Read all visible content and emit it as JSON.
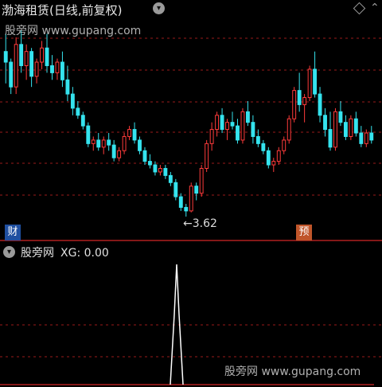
{
  "header": {
    "title": "渤海租赁(日线,前复权)",
    "dropdown_icon": "chevron-down-icon",
    "settings_icon": "diamond-icon",
    "collapse_icon": "chevron-up-icon"
  },
  "main_chart": {
    "watermark": "股旁网 www.gupang.com",
    "low_marker": "←3.62",
    "badges": {
      "finance": "财",
      "forecast": "预"
    },
    "colors": {
      "up": "#ff3b3b",
      "down": "#35e3ee",
      "grid": "#9a1a1a"
    },
    "candles": [
      [
        5.2,
        5.45,
        4.75,
        5.05
      ],
      [
        5.05,
        5.1,
        4.6,
        4.7
      ],
      [
        4.7,
        5.4,
        4.6,
        5.3
      ],
      [
        5.3,
        5.5,
        4.9,
        5.0
      ],
      [
        5.0,
        5.3,
        4.8,
        5.2
      ],
      [
        5.2,
        5.25,
        4.7,
        4.85
      ],
      [
        4.85,
        5.1,
        4.75,
        5.05
      ],
      [
        5.05,
        5.35,
        4.95,
        5.25
      ],
      [
        5.25,
        5.45,
        4.9,
        5.0
      ],
      [
        5.0,
        5.15,
        4.8,
        4.9
      ],
      [
        4.9,
        5.1,
        4.8,
        5.05
      ],
      [
        5.05,
        5.2,
        4.7,
        4.8
      ],
      [
        4.8,
        5.0,
        4.5,
        4.6
      ],
      [
        4.6,
        4.7,
        4.3,
        4.4
      ],
      [
        4.4,
        4.5,
        4.25,
        4.3
      ],
      [
        4.3,
        4.35,
        4.1,
        4.15
      ],
      [
        4.15,
        4.2,
        3.85,
        3.9
      ],
      [
        3.9,
        4.0,
        3.8,
        3.95
      ],
      [
        3.95,
        4.05,
        3.8,
        3.85
      ],
      [
        3.85,
        4.0,
        3.75,
        3.95
      ],
      [
        3.95,
        4.05,
        3.8,
        3.88
      ],
      [
        3.88,
        3.95,
        3.65,
        3.7
      ],
      [
        3.7,
        3.85,
        3.65,
        3.8
      ],
      [
        3.8,
        4.05,
        3.75,
        4.0
      ],
      [
        4.0,
        4.15,
        3.95,
        4.1
      ],
      [
        4.1,
        4.2,
        3.9,
        3.95
      ],
      [
        3.95,
        4.0,
        3.75,
        3.8
      ],
      [
        3.8,
        3.85,
        3.6,
        3.65
      ],
      [
        3.65,
        3.75,
        3.55,
        3.6
      ],
      [
        3.6,
        3.65,
        3.45,
        3.5
      ],
      [
        3.5,
        3.6,
        3.45,
        3.55
      ],
      [
        3.55,
        3.6,
        3.4,
        3.45
      ],
      [
        3.45,
        3.5,
        3.3,
        3.35
      ],
      [
        3.35,
        3.4,
        3.1,
        3.15
      ],
      [
        3.15,
        3.2,
        2.95,
        3.0
      ],
      [
        3.0,
        3.05,
        2.87,
        2.95
      ],
      [
        2.95,
        3.35,
        2.93,
        3.3
      ],
      [
        3.3,
        3.35,
        3.1,
        3.2
      ],
      [
        3.2,
        3.6,
        3.15,
        3.55
      ],
      [
        3.55,
        3.95,
        3.5,
        3.9
      ],
      [
        3.9,
        4.2,
        3.8,
        4.1
      ],
      [
        4.1,
        4.35,
        4.0,
        4.3
      ],
      [
        4.3,
        4.4,
        4.05,
        4.1
      ],
      [
        4.1,
        4.25,
        3.95,
        4.2
      ],
      [
        4.2,
        4.35,
        4.1,
        4.15
      ],
      [
        4.15,
        4.25,
        3.9,
        3.95
      ],
      [
        3.95,
        4.4,
        3.9,
        4.35
      ],
      [
        4.35,
        4.5,
        4.15,
        4.2
      ],
      [
        4.2,
        4.3,
        3.9,
        4.0
      ],
      [
        4.0,
        4.1,
        3.85,
        3.9
      ],
      [
        3.9,
        3.95,
        3.75,
        3.8
      ],
      [
        3.8,
        3.85,
        3.55,
        3.6
      ],
      [
        3.6,
        3.7,
        3.5,
        3.65
      ],
      [
        3.65,
        3.85,
        3.6,
        3.8
      ],
      [
        3.8,
        4.0,
        3.75,
        3.95
      ],
      [
        3.95,
        4.3,
        3.9,
        4.25
      ],
      [
        4.25,
        4.7,
        4.2,
        4.65
      ],
      [
        4.65,
        4.9,
        4.35,
        4.45
      ],
      [
        4.45,
        4.6,
        4.2,
        4.55
      ],
      [
        4.55,
        5.0,
        4.5,
        4.95
      ],
      [
        4.95,
        5.2,
        4.55,
        4.6
      ],
      [
        4.6,
        4.7,
        4.2,
        4.3
      ],
      [
        4.3,
        4.4,
        4.0,
        4.1
      ],
      [
        4.1,
        4.35,
        3.8,
        3.85
      ],
      [
        3.85,
        4.4,
        3.8,
        4.35
      ],
      [
        4.35,
        4.5,
        4.15,
        4.2
      ],
      [
        4.2,
        4.3,
        3.95,
        4.0
      ],
      [
        4.0,
        4.3,
        3.95,
        4.25
      ],
      [
        4.25,
        4.35,
        4.0,
        4.05
      ],
      [
        4.05,
        4.15,
        3.85,
        3.9
      ],
      [
        3.9,
        4.1,
        3.85,
        4.05
      ],
      [
        4.05,
        4.15,
        3.9,
        3.95
      ]
    ]
  },
  "sub_chart": {
    "label": "股旁网",
    "indicator": "XG: 0.00",
    "watermark": "股旁网 www.gupang.com",
    "spike_value": 1
  }
}
